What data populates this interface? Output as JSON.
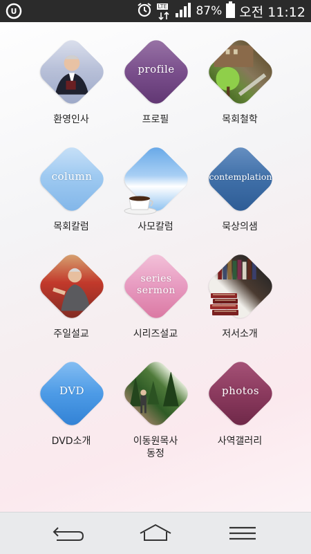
{
  "status_bar": {
    "network": "LTE",
    "battery": "87%",
    "time": "오전 11:12"
  },
  "menu": [
    {
      "label": "환영인사",
      "overlay": ""
    },
    {
      "label": "프로필",
      "overlay": "profile"
    },
    {
      "label": "목회철학",
      "overlay": ""
    },
    {
      "label": "목회칼럼",
      "overlay": "column"
    },
    {
      "label": "사모칼럼",
      "overlay": ""
    },
    {
      "label": "묵상의샘",
      "overlay": "contemplation"
    },
    {
      "label": "주일설교",
      "overlay": ""
    },
    {
      "label": "시리즈설교",
      "overlay": "series\nsermon"
    },
    {
      "label": "저서소개",
      "overlay": ""
    },
    {
      "label": "DVD소개",
      "overlay": "DVD"
    },
    {
      "label": "이동원목사\n동정",
      "overlay": ""
    },
    {
      "label": "사역갤러리",
      "overlay": "photos"
    }
  ],
  "colors": {
    "status_bar": "#2b2b2b",
    "nav_bar": "#e9eaec",
    "profile": "#7a4f8c",
    "column": "#8fc0ee",
    "contemplation": "#3f6fa8",
    "series": "#e79ac0",
    "dvd": "#4d9be6",
    "photos": "#8b3a5e"
  },
  "nav": {
    "back_icon": "back-arrow-icon",
    "home_icon": "home-icon",
    "menu_icon": "menu-icon"
  }
}
